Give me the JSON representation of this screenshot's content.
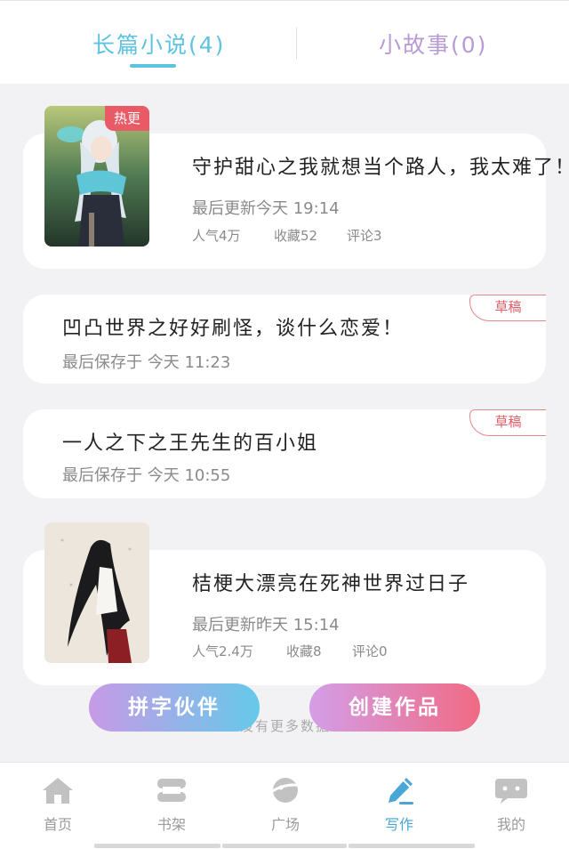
{
  "top_tabs": [
    {
      "label": "长篇小说(4)"
    },
    {
      "label": "小故事(0)"
    }
  ],
  "works": [
    {
      "title": "守护甜心之我就想当个路人，我太难了！",
      "badge": "热更",
      "meta": "最后更新今天 19:14",
      "stats": [
        "人气4万",
        "收藏52",
        "评论3"
      ]
    },
    {
      "title": "凹凸世界之好好刷怪，谈什么恋爱！",
      "badge": "草稿",
      "meta": "最后保存于 今天 11:23"
    },
    {
      "title": "一人之下之王先生的百小姐",
      "badge": "草稿",
      "meta": "最后保存于 今天 10:55"
    },
    {
      "title": "桔梗大漂亮在死神世界过日子",
      "meta": "最后更新昨天 15:14",
      "stats": [
        "人气2.4万",
        "收藏8",
        "评论0"
      ]
    }
  ],
  "actions": {
    "partner_label": "拼字伙伴",
    "create_label": "创建作品"
  },
  "list_footer": "没有更多数据",
  "bottom_nav": [
    {
      "label": "首页",
      "icon": "home-icon"
    },
    {
      "label": "书架",
      "icon": "bookshelf-icon"
    },
    {
      "label": "广场",
      "icon": "planet-icon"
    },
    {
      "label": "写作",
      "icon": "pen-icon",
      "active": true
    },
    {
      "label": "我的",
      "icon": "chat-bubble-icon"
    }
  ],
  "colors": {
    "accent": "#5ec3e0",
    "secondary": "#b89ad4",
    "hot": "#e85a66",
    "draft": "#e05c66"
  }
}
